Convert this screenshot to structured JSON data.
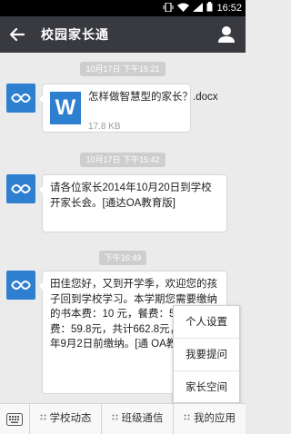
{
  "status": {
    "time": "16:52"
  },
  "header": {
    "title": "校园家长通"
  },
  "messages": [
    {
      "time": "10月17日 下午15:21",
      "file": {
        "icon": "W",
        "name": "怎样做智慧型的家长？.docx",
        "size": "17.8 KB"
      }
    },
    {
      "time": "10月17日 下午15:42",
      "text": "请各位家长2014年10月20日到学校开家长会。[通达OA教育版]"
    },
    {
      "time": "下午16:49",
      "text": "田佳您好，又到开学季，欢迎您的孩子回到学校学习。本学期您需要缴纳的书本费：10 元，餐费：500元，杂费：59.8元，共计662.8元，请 2014年9月2日前缴纳。[通 OA教育版]"
    }
  ],
  "popup_menu": {
    "items": [
      "个人设置",
      "我要提问",
      "家长空间"
    ]
  },
  "bottom_menu": {
    "items": [
      "学校动态",
      "班级通信",
      "我的应用"
    ]
  }
}
